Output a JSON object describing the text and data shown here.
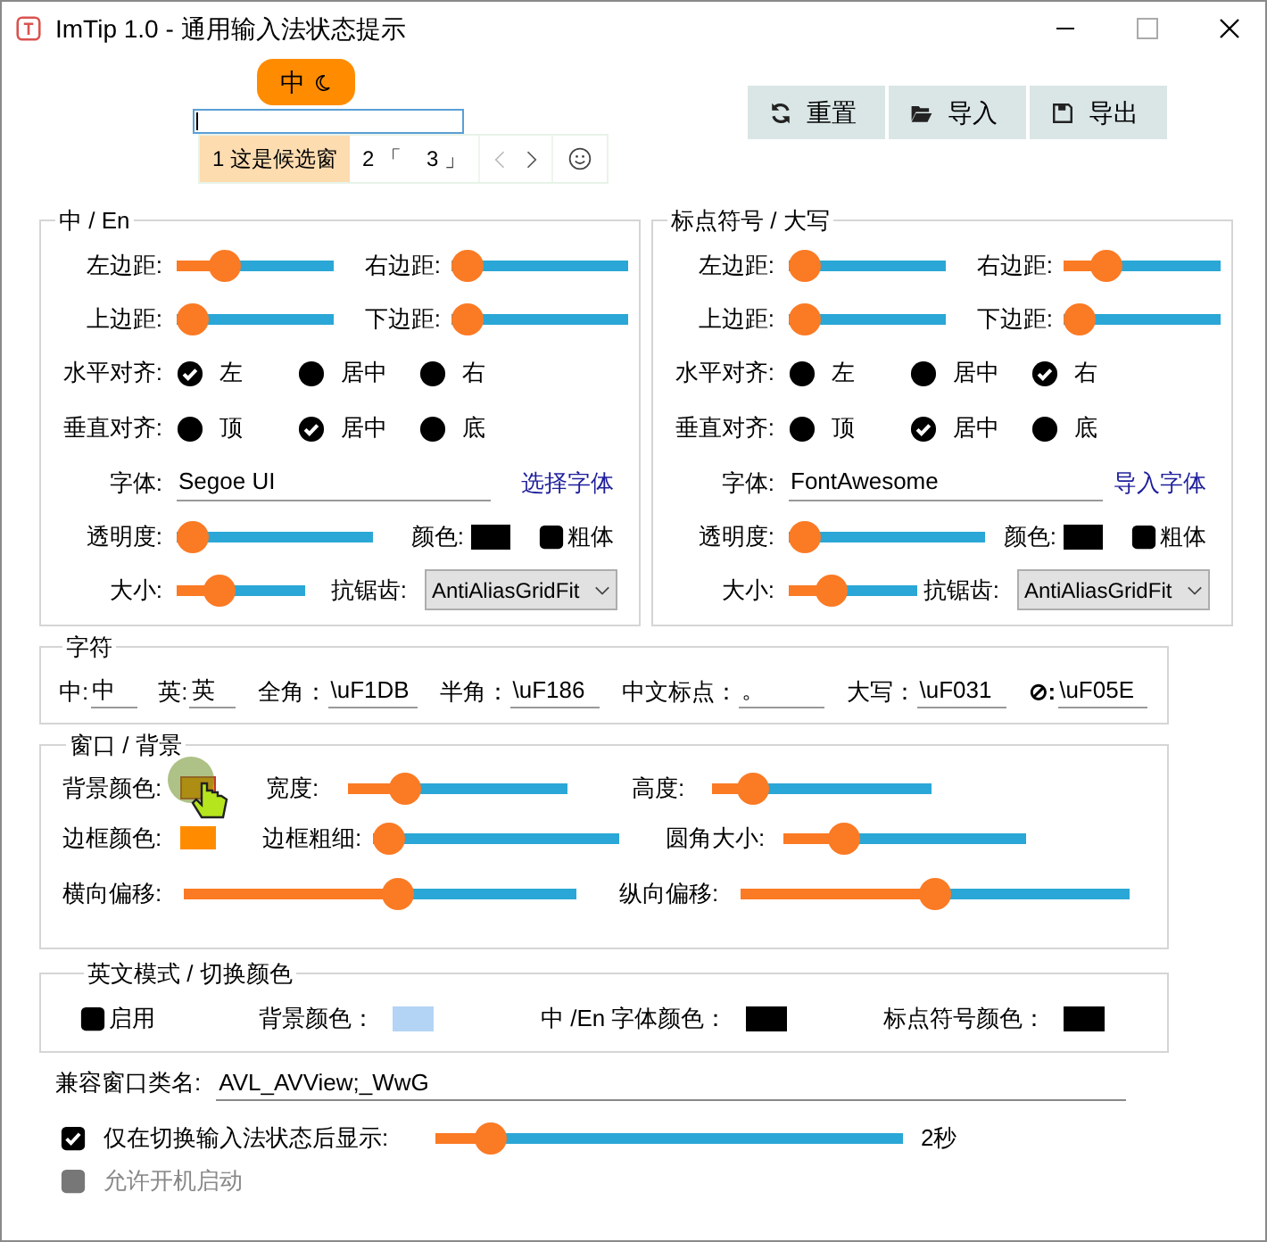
{
  "window": {
    "title": "ImTip 1.0 - 通用输入法状态提示"
  },
  "preview": {
    "tip_label": "中",
    "candidates": [
      {
        "index": "1",
        "text": "这是候选窗",
        "selected": true
      },
      {
        "index": "2",
        "text": "「",
        "selected": false
      },
      {
        "index": "3",
        "text": "」",
        "selected": false
      }
    ]
  },
  "toolbar": [
    {
      "label": "重置",
      "kind": "reset"
    },
    {
      "label": "导入",
      "kind": "import"
    },
    {
      "label": "导出",
      "kind": "export"
    }
  ],
  "panels": [
    {
      "title": "中 / En",
      "margins": [
        {
          "label": "左边距:",
          "level": 0.25
        },
        {
          "label": "右边距:",
          "level": 0
        },
        {
          "label": "上边距:",
          "level": 0
        },
        {
          "label": "下边距:",
          "level": 0
        }
      ],
      "h_align": {
        "label": "水平对齐:",
        "options": [
          {
            "label": "左",
            "selected": true
          },
          {
            "label": "居中",
            "selected": false
          },
          {
            "label": "右",
            "selected": false
          }
        ]
      },
      "v_align": {
        "label": "垂直对齐:",
        "options": [
          {
            "label": "顶",
            "selected": false
          },
          {
            "label": "居中",
            "selected": true
          },
          {
            "label": "底",
            "selected": false
          }
        ]
      },
      "font": {
        "label": "字体:",
        "value": "Segoe UI",
        "link": "选择字体"
      },
      "opacity": {
        "label": "透明度:",
        "level": 0
      },
      "color": {
        "label": "颜色:",
        "color": "#000000"
      },
      "bold": {
        "label": "粗体",
        "checked": false
      },
      "size": {
        "label": "大小:",
        "level": 0.28
      },
      "antialias": {
        "label": "抗锯齿:",
        "value": "AntiAliasGridFit"
      }
    },
    {
      "title": "标点符号 / 大写",
      "margins": [
        {
          "label": "左边距:",
          "level": 0
        },
        {
          "label": "右边距:",
          "level": 0.22
        },
        {
          "label": "上边距:",
          "level": 0
        },
        {
          "label": "下边距:",
          "level": 0
        }
      ],
      "h_align": {
        "label": "水平对齐:",
        "options": [
          {
            "label": "左",
            "selected": false
          },
          {
            "label": "居中",
            "selected": false
          },
          {
            "label": "右",
            "selected": true
          }
        ]
      },
      "v_align": {
        "label": "垂直对齐:",
        "options": [
          {
            "label": "顶",
            "selected": false
          },
          {
            "label": "居中",
            "selected": true
          },
          {
            "label": "底",
            "selected": false
          }
        ]
      },
      "font": {
        "label": "字体:",
        "value": "FontAwesome",
        "link": "导入字体"
      },
      "opacity": {
        "label": "透明度:",
        "level": 0
      },
      "color": {
        "label": "颜色:",
        "color": "#000000"
      },
      "bold": {
        "label": "粗体",
        "checked": false
      },
      "size": {
        "label": "大小:",
        "level": 0.27
      },
      "antialias": {
        "label": "抗锯齿:",
        "value": "AntiAliasGridFit"
      }
    }
  ],
  "chars": {
    "title": "字符",
    "fields": [
      {
        "label": "中:",
        "value": "中"
      },
      {
        "label": "英:",
        "value": "英"
      },
      {
        "label": "全角：",
        "value": "\\uF1DB"
      },
      {
        "label": "半角：",
        "value": "\\uF186"
      },
      {
        "label": "中文标点：",
        "value": "。"
      },
      {
        "label": "大写：",
        "value": "\\uF031"
      },
      {
        "label": "⊘:",
        "value": "\\uF05E"
      }
    ]
  },
  "window_bg": {
    "title": "窗口 / 背景",
    "swatches": [
      {
        "label": "背景颜色:",
        "color": "#ff8c00"
      },
      {
        "label": "边框颜色:",
        "color": "#ff8c00"
      }
    ],
    "sliders": [
      {
        "label": "宽度:",
        "level": 0.22
      },
      {
        "label": "高度:",
        "level": 0.13
      },
      {
        "label": "边框粗细:",
        "level": 0
      },
      {
        "label": "圆角大小:",
        "level": 0.21
      },
      {
        "label": "横向偏移:",
        "level": 0.55
      },
      {
        "label": "纵向偏移:",
        "level": 0.5
      }
    ]
  },
  "english_mode": {
    "title": "英文模式 / 切换颜色",
    "enable": {
      "label": "启用",
      "checked": false
    },
    "colors": [
      {
        "label": "背景颜色：",
        "color": "#b3d4f5"
      },
      {
        "label": "中 /En 字体颜色：",
        "color": "#000000"
      },
      {
        "label": "标点符号颜色：",
        "color": "#000000"
      }
    ]
  },
  "class_name": {
    "label": "兼容窗口类名:",
    "value": "AVL_AVView;_WwG"
  },
  "show_after_switch": {
    "label": "仅在切换输入法状态后显示:",
    "checked": true,
    "level": 0.09,
    "reading": "2秒"
  },
  "autostart": {
    "label": "允许开机启动",
    "checked": false,
    "disabled": true
  }
}
